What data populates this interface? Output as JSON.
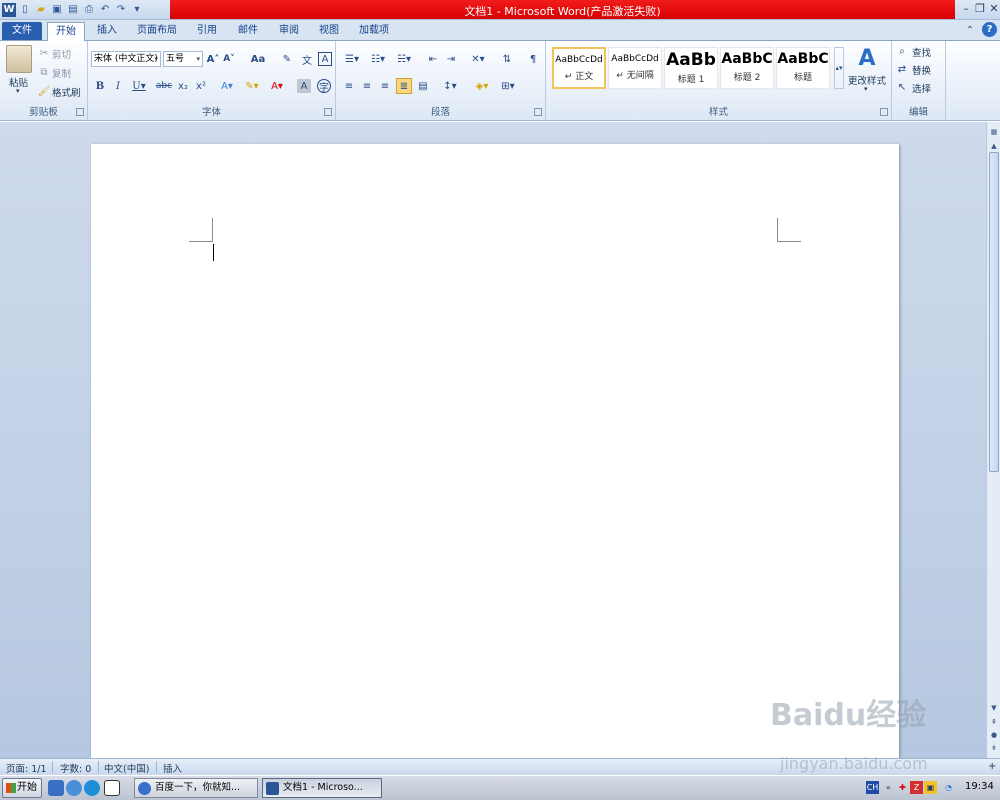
{
  "window": {
    "title": "文档1 - Microsoft Word(产品激活失败)"
  },
  "tabs": [
    "文件",
    "开始",
    "插入",
    "页面布局",
    "引用",
    "邮件",
    "审阅",
    "视图",
    "加载项"
  ],
  "clipboard": {
    "paste": "粘贴",
    "cut": "剪切",
    "copy": "复制",
    "format_painter": "格式刷",
    "group": "剪贴板"
  },
  "font": {
    "family": "宋体 (中文正文)",
    "size": "五号",
    "change_case": "Aa",
    "group": "字体"
  },
  "paragraph": {
    "group": "段落"
  },
  "styles": {
    "group": "样式",
    "change_styles": "更改样式",
    "items": [
      {
        "sample": "AaBbCcDd",
        "name": "↵ 正文"
      },
      {
        "sample": "AaBbCcDd",
        "name": "↵ 无间隔"
      },
      {
        "sample": "AaBb",
        "name": "标题 1"
      },
      {
        "sample": "AaBbC",
        "name": "标题 2"
      },
      {
        "sample": "AaBbC",
        "name": "标题"
      }
    ]
  },
  "editing": {
    "find": "查找",
    "replace": "替换",
    "select": "选择",
    "group": "编辑"
  },
  "status": {
    "page": "页面: 1/1",
    "words": "字数: 0",
    "language": "中文(中国)",
    "mode": "插入"
  },
  "taskbar": {
    "start": "开始",
    "tasks": [
      "百度一下，你就知...",
      "文档1 - Microso..."
    ],
    "ime": "CH",
    "clock": "19:34"
  },
  "watermark": {
    "brand": "Baidu经验",
    "url": "jingyan.baidu.com"
  },
  "colors": {
    "title_red": "#e00000",
    "file_tab": "#2a5fb0",
    "ribbon_bg": "#dde8f5",
    "workspace_bg": "#c3d3e9"
  }
}
